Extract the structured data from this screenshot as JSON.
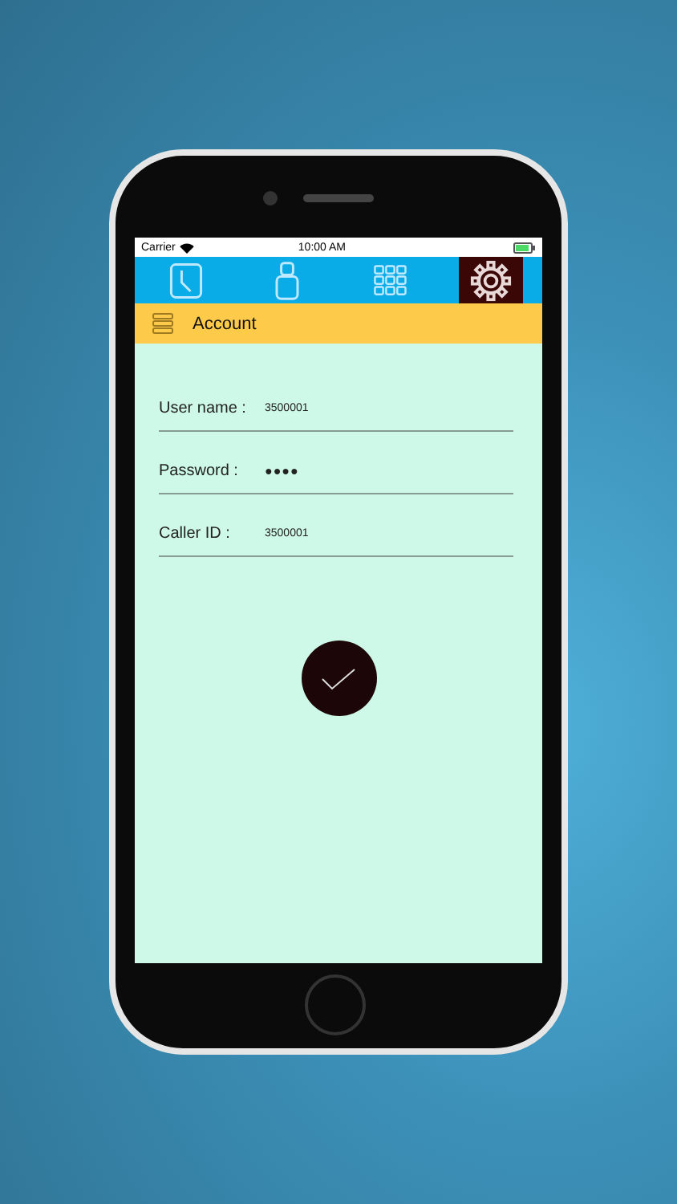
{
  "status_bar": {
    "carrier": "Carrier",
    "time": "10:00 AM"
  },
  "tabs": [
    {
      "kind": "clock",
      "selected": false
    },
    {
      "kind": "phone",
      "selected": false
    },
    {
      "kind": "grid",
      "selected": false
    },
    {
      "kind": "gear",
      "selected": true
    }
  ],
  "header": {
    "title": "Account"
  },
  "fields": [
    {
      "label": "User name :",
      "value": "3500001",
      "kind": "text"
    },
    {
      "label": "Password :",
      "value": "●●●●",
      "kind": "password"
    },
    {
      "label": "Caller ID :",
      "value": "3500001",
      "kind": "text"
    }
  ]
}
